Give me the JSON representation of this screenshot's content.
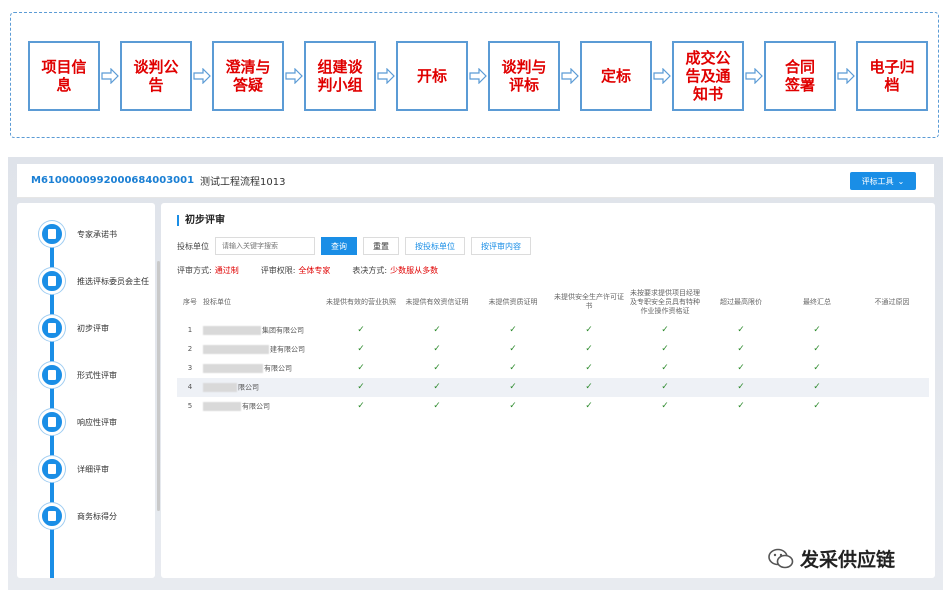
{
  "flow": {
    "steps": [
      "项目信\n息",
      "谈判公\n告",
      "澄清与\n答疑",
      "组建谈\n判小组",
      "开标",
      "谈判与\n评标",
      "定标",
      "成交公\n告及通\n知书",
      "合同\n签署",
      "电子归\n档"
    ]
  },
  "header": {
    "project_code": "M6100000992000684003001",
    "project_name": "测试工程流程1013",
    "tool_button": "评标工具"
  },
  "sidebar": {
    "items": [
      "专家承诺书",
      "推选评标委员会主任",
      "初步评审",
      "形式性评审",
      "响应性评审",
      "详细评审",
      "商务标得分"
    ]
  },
  "main": {
    "title": "初步评审",
    "filter_label": "投标单位",
    "search_placeholder": "请输入关键字搜索",
    "buttons": {
      "query": "查询",
      "reset": "重置",
      "by_bidder": "按投标单位",
      "by_content": "按评审内容"
    },
    "meta": {
      "method_label": "评审方式:",
      "method_value": "通过制",
      "authority_label": "评审权限:",
      "authority_value": "全体专家",
      "vote_label": "表决方式:",
      "vote_value": "少数服从多数"
    },
    "table": {
      "headers": [
        "序号",
        "投标单位",
        "未提供有效的营业执照",
        "未提供有效资信证明",
        "未提供资质证明",
        "未提供安全生产许可证书",
        "未按要求提供项目经理及专职安全员具有特种作业操作资格证",
        "超过最高限价",
        "最终汇总",
        "不通过原因"
      ],
      "rows": [
        {
          "no": "1",
          "bidder": "集团有限公司"
        },
        {
          "no": "2",
          "bidder": "建有限公司"
        },
        {
          "no": "3",
          "bidder": "有限公司"
        },
        {
          "no": "4",
          "bidder": "限公司"
        },
        {
          "no": "5",
          "bidder": "有限公司"
        }
      ]
    }
  },
  "watermark": "发采供应链",
  "colors": {
    "accent": "#1a8ee6",
    "flow_border": "#5b9bd5",
    "flow_text": "#e00000"
  }
}
